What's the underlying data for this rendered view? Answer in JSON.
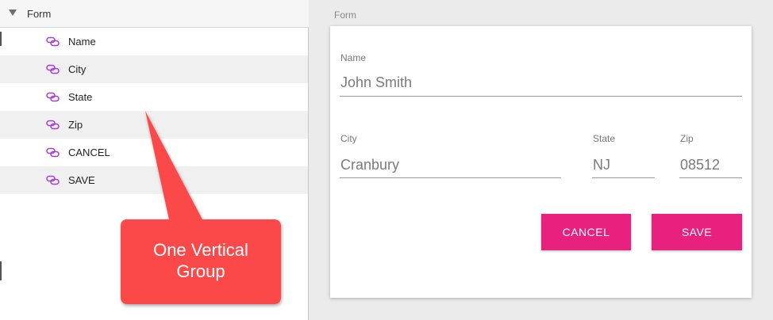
{
  "layers_panel": {
    "group_title": "Form",
    "items": [
      {
        "label": "Name"
      },
      {
        "label": "City"
      },
      {
        "label": "State"
      },
      {
        "label": "Zip"
      },
      {
        "label": "CANCEL"
      },
      {
        "label": "SAVE"
      }
    ],
    "icon": "link-icon",
    "icon_color": "#a23fd0"
  },
  "callout": {
    "text_line1": "One Vertical",
    "text_line2": "Group",
    "color": "#fb4a4a"
  },
  "form": {
    "section_label": "Form",
    "name": {
      "label": "Name",
      "value": "John Smith"
    },
    "city": {
      "label": "City",
      "value": "Cranbury"
    },
    "state": {
      "label": "State",
      "value": "NJ"
    },
    "zip": {
      "label": "Zip",
      "value": "08512"
    },
    "cancel_label": "CANCEL",
    "save_label": "SAVE",
    "accent_color": "#e8207e"
  }
}
